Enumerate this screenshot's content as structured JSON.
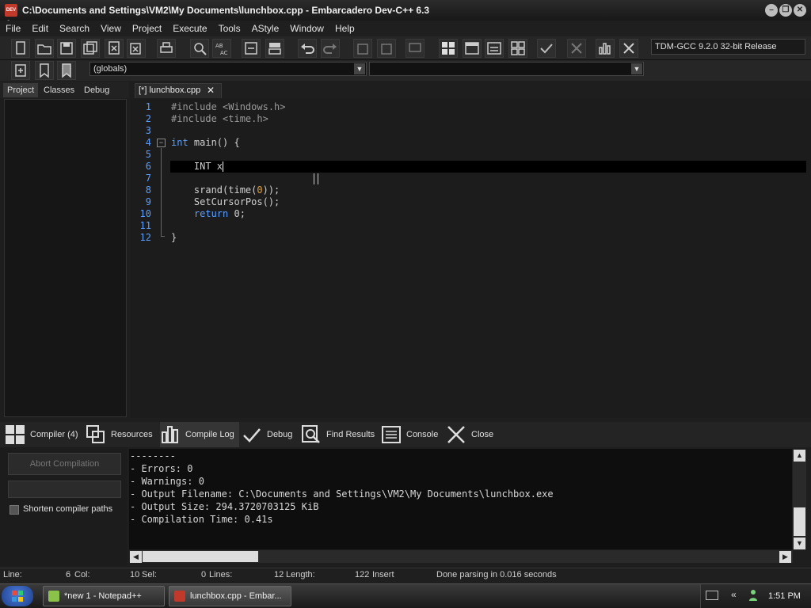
{
  "window": {
    "title": "C:\\Documents and Settings\\VM2\\My Documents\\lunchbox.cpp - Embarcadero Dev-C++ 6.3",
    "app_icon_text": "DEV C++"
  },
  "menu": [
    "File",
    "Edit",
    "Search",
    "View",
    "Project",
    "Execute",
    "Tools",
    "AStyle",
    "Window",
    "Help"
  ],
  "toolbar": {
    "compiler": "TDM-GCC 9.2.0 32-bit Release",
    "scope": "(globals)",
    "function": ""
  },
  "left_tabs": [
    "Project",
    "Classes",
    "Debug"
  ],
  "editor": {
    "tab_label": "[*] lunchbox.cpp",
    "lines": [
      {
        "num": "1",
        "segments": [
          {
            "t": "#include <Windows.h>",
            "c": "#9a9a9a"
          }
        ]
      },
      {
        "num": "2",
        "segments": [
          {
            "t": "#include <time.h>",
            "c": "#9a9a9a"
          }
        ]
      },
      {
        "num": "3",
        "segments": []
      },
      {
        "num": "4",
        "segments": [
          {
            "t": "int",
            "c": "#5c9fff"
          },
          {
            "t": " main() {",
            "c": "#d0d0d0"
          }
        ]
      },
      {
        "num": "5",
        "segments": []
      },
      {
        "num": "6",
        "segments": [
          {
            "t": "    INT x",
            "c": "#d0d0d0"
          }
        ]
      },
      {
        "num": "7",
        "segments": []
      },
      {
        "num": "8",
        "segments": [
          {
            "t": "    srand(time(",
            "c": "#d0d0d0"
          },
          {
            "t": "0",
            "c": "#e0a040"
          },
          {
            "t": "));",
            "c": "#d0d0d0"
          }
        ]
      },
      {
        "num": "9",
        "segments": [
          {
            "t": "    SetCursorPos();",
            "c": "#d0d0d0"
          }
        ]
      },
      {
        "num": "10",
        "segments": [
          {
            "t": "    ",
            "c": "#d0d0d0"
          },
          {
            "t": "return",
            "c": "#5c9fff"
          },
          {
            "t": " 0;",
            "c": "#d0d0d0"
          }
        ]
      },
      {
        "num": "11",
        "segments": []
      },
      {
        "num": "12",
        "segments": [
          {
            "t": "}",
            "c": "#d0d0d0"
          }
        ]
      }
    ]
  },
  "bottom_tabs": [
    "Compiler (4)",
    "Resources",
    "Compile Log",
    "Debug",
    "Find Results",
    "Console",
    "Close"
  ],
  "compile_panel": {
    "abort_label": "Abort Compilation",
    "shorten_label": "Shorten compiler paths"
  },
  "log": [
    "--------",
    "- Errors: 0",
    "- Warnings: 0",
    "- Output Filename: C:\\Documents and Settings\\VM2\\My Documents\\lunchbox.exe",
    "- Output Size: 294.3720703125 KiB",
    "- Compilation Time: 0.41s"
  ],
  "status": {
    "line_label": "Line:",
    "line_value": "6",
    "col_label": "Col:",
    "col_value": "10",
    "sel_label": "Sel:",
    "sel_value": "0",
    "lines_label": "Lines:",
    "lines_value": "12",
    "length_label": "Length:",
    "length_value": "122",
    "mode": "Insert",
    "message": "Done parsing in 0.016 seconds"
  },
  "taskbar": {
    "tasks": [
      "*new 1 - Notepad++",
      "lunchbox.cpp - Embar..."
    ],
    "clock": "1:51 PM"
  },
  "colors": {
    "line_number": "#5c9fff",
    "keyword": "#5c9fff",
    "preprocessor": "#9a9a9a",
    "number": "#e0a040"
  }
}
